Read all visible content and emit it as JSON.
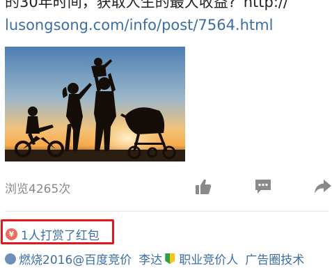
{
  "post": {
    "line1": "的30年时间，获取人生的最大收益?”http://",
    "line2_link": "lusongsong.com/info/post/7564.html"
  },
  "stats": {
    "views_label": "浏览4265次"
  },
  "actions": {
    "like_icon": "thumbs-up-icon",
    "comment_icon": "comment-icon",
    "share_icon": "share-arrow-icon"
  },
  "reward": {
    "icon": "yen-icon",
    "label": "1人打赏了红包",
    "highlight_color": "#e8141a"
  },
  "rewarders": {
    "user1": "燃烧2016@百度竞价",
    "user2": "李达",
    "user2_title": "职业竞价人",
    "user3": "广告圈技术"
  },
  "colors": {
    "link": "#3b6ea5",
    "muted": "#888888"
  }
}
